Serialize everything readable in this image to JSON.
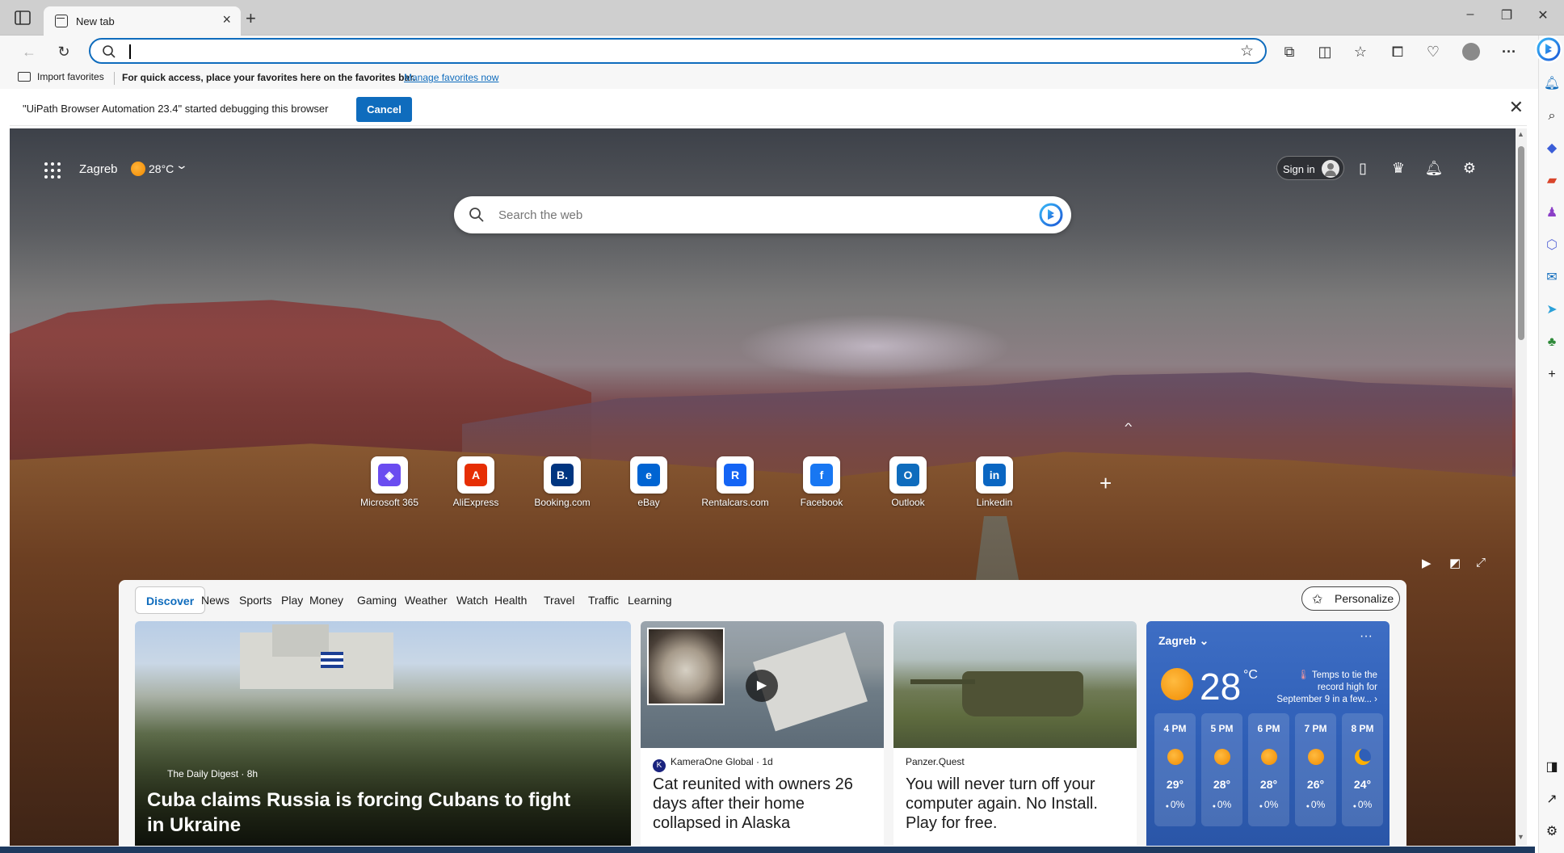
{
  "browser": {
    "tab_title": "New tab",
    "address_value": "",
    "favorites_bar": {
      "import_label": "Import favorites",
      "message": "For quick access, place your favorites here on the favorites bar.",
      "manage_link": "Manage favorites now"
    },
    "infobar": {
      "message": "\"UiPath Browser Automation 23.4\" started debugging this browser",
      "cancel_label": "Cancel"
    }
  },
  "ntp": {
    "location": "Zagreb",
    "temperature": "28°C",
    "signin_label": "Sign in",
    "search_placeholder": "Search the web",
    "quick_links": [
      {
        "label": "Microsoft 365",
        "icon": "microsoft-365-icon",
        "color": "#6a4cf0"
      },
      {
        "label": "AliExpress",
        "icon": "aliexpress-icon",
        "color": "#e62e04"
      },
      {
        "label": "Booking.com",
        "icon": "booking-icon",
        "color": "#003580"
      },
      {
        "label": "eBay",
        "icon": "ebay-icon",
        "color": "#0064d2"
      },
      {
        "label": "Rentalcars.com",
        "icon": "rentalcars-icon",
        "color": "#1464f4"
      },
      {
        "label": "Facebook",
        "icon": "facebook-icon",
        "color": "#1877f2"
      },
      {
        "label": "Outlook",
        "icon": "outlook-icon",
        "color": "#0f6cbd"
      },
      {
        "label": "Linkedin",
        "icon": "linkedin-icon",
        "color": "#0a66c2"
      }
    ]
  },
  "feed": {
    "tabs": [
      "Discover",
      "News",
      "Sports",
      "Play",
      "Money",
      "Gaming",
      "Weather",
      "Watch",
      "Health",
      "Travel",
      "Traffic",
      "Learning"
    ],
    "active_tab": "Discover",
    "personalize_label": "Personalize",
    "cards": [
      {
        "source": "The Daily Digest · 8h",
        "headline": "Cuba claims Russia is forcing Cubans to fight in Ukraine"
      },
      {
        "source": "KameraOne Global · 1d",
        "headline": "Cat reunited with owners 26 days after their home collapsed in Alaska"
      },
      {
        "source": "Panzer.Quest",
        "headline": "You will never turn off your computer again. No Install. Play for free."
      }
    ],
    "weather": {
      "city": "Zagreb",
      "temp": "28",
      "unit": "°C",
      "alert": "Temps to tie the record high for September 9 in a few...",
      "hours": [
        {
          "time": "4 PM",
          "temp": "29°",
          "precip": "0%",
          "icon": "sun-icon"
        },
        {
          "time": "5 PM",
          "temp": "28°",
          "precip": "0%",
          "icon": "sun-icon"
        },
        {
          "time": "6 PM",
          "temp": "28°",
          "precip": "0%",
          "icon": "sun-icon"
        },
        {
          "time": "7 PM",
          "temp": "26°",
          "precip": "0%",
          "icon": "sun-icon"
        },
        {
          "time": "8 PM",
          "temp": "24°",
          "precip": "0%",
          "icon": "moon-icon"
        }
      ]
    }
  },
  "colors": {
    "accent": "#0f6cbd",
    "weather_card": "#2f5fb7"
  }
}
